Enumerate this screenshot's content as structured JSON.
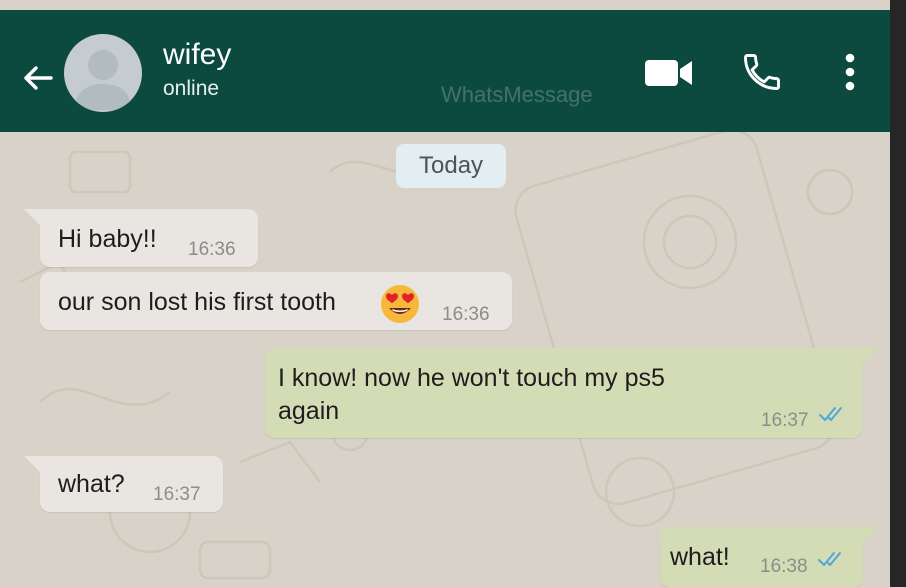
{
  "header": {
    "contact_name": "wifey",
    "status": "online",
    "watermark": "WhatsMessage",
    "icons": [
      "back-arrow-icon",
      "avatar-placeholder-icon",
      "video-call-icon",
      "phone-icon",
      "more-vertical-icon"
    ],
    "color": "#0c4a40"
  },
  "chat": {
    "date_chip": "Today",
    "messages": [
      {
        "direction": "incoming",
        "text": "Hi baby!!",
        "time": "16:36"
      },
      {
        "direction": "incoming",
        "text": "our son lost his first tooth",
        "emoji": "heart-eyes-emoji",
        "time": "16:36"
      },
      {
        "direction": "outgoing",
        "text": "I know! now he won't touch my ps5\nagain",
        "time": "16:37",
        "status": "read"
      },
      {
        "direction": "incoming",
        "text": "what?",
        "time": "16:37"
      },
      {
        "direction": "outgoing",
        "text": "what!",
        "time": "16:38",
        "status": "read"
      }
    ],
    "colors": {
      "incoming_bubble": "#e9e6e2",
      "outgoing_bubble": "#d4dcb6",
      "read_ticks": "#4fa6d8",
      "background": "#d8d2c8"
    }
  }
}
